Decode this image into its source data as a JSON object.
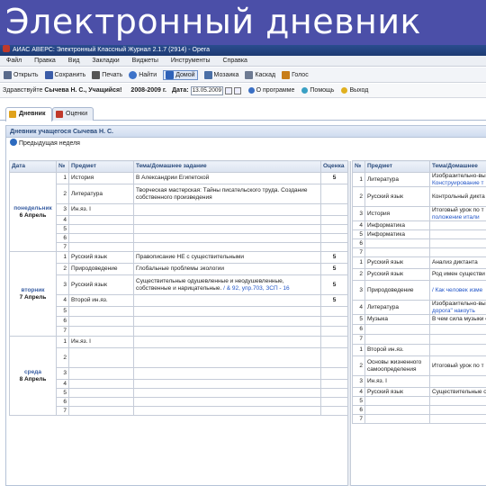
{
  "banner": "Электронный дневник",
  "window_title": "АИАС АВЕРС: Электронный Классный Журнал 2.1.7 (2914) - Opera",
  "menu": [
    "Файл",
    "Правка",
    "Вид",
    "Закладки",
    "Виджеты",
    "Инструменты",
    "Справка"
  ],
  "toolbar": [
    {
      "icon": "folder-open-icon",
      "label": "Открыть",
      "color": "#5a6b8c"
    },
    {
      "icon": "save-icon",
      "label": "Сохранить",
      "color": "#3b5ca8"
    },
    {
      "icon": "print-icon",
      "label": "Печать",
      "color": "#555555"
    },
    {
      "icon": "search-icon",
      "label": "Найти",
      "color": "#3d73c9"
    },
    {
      "icon": "home-icon",
      "label": "Домой",
      "color": "#2e62b8"
    },
    {
      "icon": "mosaic-icon",
      "label": "Мозаика",
      "color": "#4a6fa6"
    },
    {
      "icon": "cascade-icon",
      "label": "Каскад",
      "color": "#6d7a92"
    },
    {
      "icon": "voice-icon",
      "label": "Голос",
      "color": "#c77d1a"
    }
  ],
  "session": {
    "greeting": "Здравствуйте",
    "user": "Сычева Н. С., Учащийся!",
    "year": "2008-2009 г.",
    "date_label": "Дата:",
    "date_value": "13.05.2009",
    "about": "О программе",
    "help": "Помощь",
    "exit": "Выход"
  },
  "tabs": [
    {
      "label": "Дневник",
      "color": "#e0a21b"
    },
    {
      "label": "Оценки",
      "color": "#c0392b"
    }
  ],
  "diary_title": "Дневник учащегося Сычева Н. С.",
  "prev_week": "Предыдущая неделя",
  "columns_left": [
    "Дата",
    "№",
    "Предмет",
    "Тема/Домашнее задание",
    "Оценка"
  ],
  "columns_right": [
    "№",
    "Предмет",
    "Тема/Домашнее"
  ],
  "left_days": [
    {
      "day": "понедельник",
      "date": "6 Апрель",
      "rows": [
        {
          "n": "1",
          "subject": "История",
          "topic": "В Александрии Египетской",
          "grade": "5"
        },
        {
          "n": "2",
          "subject": "Литература",
          "topic": "Творческая мастерская: Тайны писательского труда. Создание собственного произведения",
          "grade": ""
        },
        {
          "n": "3",
          "subject": "Ин.яз. I",
          "topic": "",
          "grade": ""
        },
        {
          "n": "4",
          "subject": "",
          "topic": "",
          "grade": ""
        },
        {
          "n": "5",
          "subject": "",
          "topic": "",
          "grade": ""
        },
        {
          "n": "6",
          "subject": "",
          "topic": "",
          "grade": ""
        },
        {
          "n": "7",
          "subject": "",
          "topic": "",
          "grade": ""
        }
      ]
    },
    {
      "day": "вторник",
      "date": "7 Апрель",
      "rows": [
        {
          "n": "1",
          "subject": "Русский язык",
          "topic": "Правописание НЕ с существительными",
          "grade": "5"
        },
        {
          "n": "2",
          "subject": "Природоведение",
          "topic": "Глобальные проблемы экологии",
          "grade": "5"
        },
        {
          "n": "3",
          "subject": "Русский язык",
          "topic": "Существительные одушевленные и неодушевленные, собственные и нарицательные.",
          "topic_link": "/ & 92, упр.703, ЗСП - 16",
          "grade": "5"
        },
        {
          "n": "4",
          "subject": "Второй ин.яз.",
          "topic": "",
          "grade": "5"
        },
        {
          "n": "5",
          "subject": "",
          "topic": "",
          "grade": ""
        },
        {
          "n": "6",
          "subject": "",
          "topic": "",
          "grade": ""
        },
        {
          "n": "7",
          "subject": "",
          "topic": "",
          "grade": ""
        }
      ]
    },
    {
      "day": "среда",
      "date": "8 Апрель",
      "rows": [
        {
          "n": "1",
          "subject": "Ин.яз. I",
          "topic": "",
          "grade": ""
        },
        {
          "n": "2",
          "subject": "",
          "topic": "",
          "grade": ""
        },
        {
          "n": "3",
          "subject": "",
          "topic": "",
          "grade": ""
        },
        {
          "n": "4",
          "subject": "",
          "topic": "",
          "grade": ""
        },
        {
          "n": "5",
          "subject": "",
          "topic": "",
          "grade": ""
        },
        {
          "n": "6",
          "subject": "",
          "topic": "",
          "grade": ""
        },
        {
          "n": "7",
          "subject": "",
          "topic": "",
          "grade": ""
        }
      ]
    }
  ],
  "right_days": [
    {
      "rows": [
        {
          "n": "1",
          "subject": "Литература",
          "topic": "Изобразительно-вы",
          "topic_link": "Конструирование т"
        },
        {
          "n": "2",
          "subject": "Русский язык",
          "topic": "Контрольный дикта"
        },
        {
          "n": "3",
          "subject": "История",
          "topic": "Итоговый урок по т",
          "topic_link": "положение итали"
        },
        {
          "n": "4",
          "subject": "Информатика",
          "topic": ""
        },
        {
          "n": "5",
          "subject": "Информатика",
          "topic": ""
        },
        {
          "n": "6",
          "subject": "",
          "topic": ""
        },
        {
          "n": "7",
          "subject": "",
          "topic": ""
        }
      ]
    },
    {
      "rows": [
        {
          "n": "1",
          "subject": "Русский язык",
          "topic": "Анализ диктанта"
        },
        {
          "n": "2",
          "subject": "Русский язык",
          "topic": "Род имен существи"
        },
        {
          "n": "3",
          "subject": "Природоведение",
          "topic": "",
          "topic_link": "/ Как человек изме"
        },
        {
          "n": "4",
          "subject": "Литература",
          "topic": "Изобразительно-вы",
          "topic_link": "дорога\" накоуть"
        },
        {
          "n": "5",
          "subject": "Музыка",
          "topic": "В чем сила музыки с"
        },
        {
          "n": "6",
          "subject": "",
          "topic": ""
        },
        {
          "n": "7",
          "subject": "",
          "topic": ""
        }
      ]
    },
    {
      "rows": [
        {
          "n": "1",
          "subject": "Второй ин.яз.",
          "topic": ""
        },
        {
          "n": "2",
          "subject": "Основы жизненного самоопределения",
          "topic": "Итоговый урок по т"
        },
        {
          "n": "3",
          "subject": "Ин.яз. I",
          "topic": ""
        },
        {
          "n": "4",
          "subject": "Русский язык",
          "topic": "Существительные о существительные/"
        },
        {
          "n": "5",
          "subject": "",
          "topic": ""
        },
        {
          "n": "6",
          "subject": "",
          "topic": ""
        },
        {
          "n": "7",
          "subject": "",
          "topic": ""
        }
      ]
    }
  ]
}
